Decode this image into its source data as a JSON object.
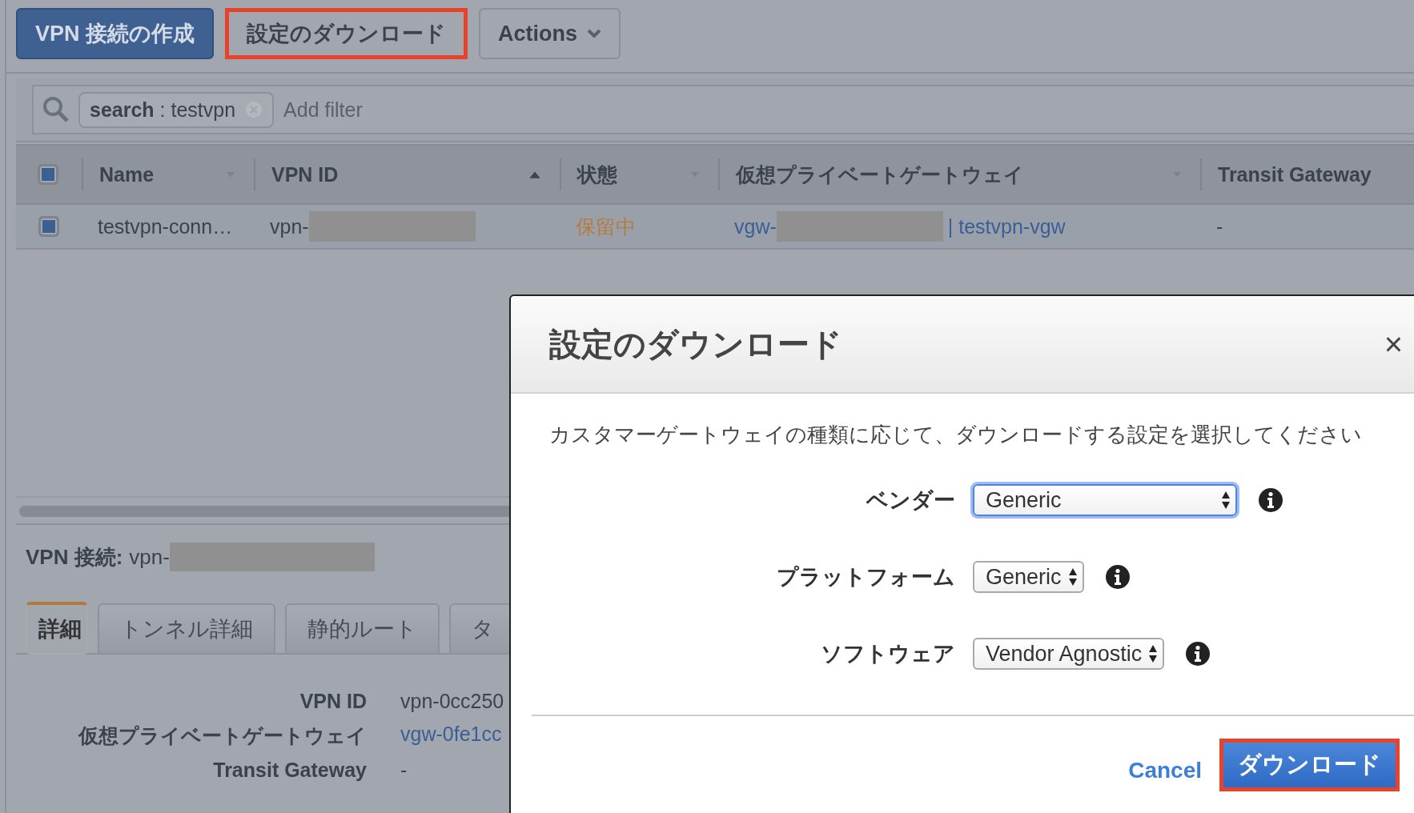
{
  "toolbar": {
    "buttons": [
      {
        "label": "VPN 接続の作成",
        "kind": "primary",
        "highlighted": false
      },
      {
        "label": "設定のダウンロード",
        "kind": "default",
        "highlighted": true
      },
      {
        "label": "Actions",
        "kind": "menu",
        "highlighted": false
      }
    ]
  },
  "filter": {
    "chip": "**search** : testvpn",
    "placeholder": "Add filter"
  },
  "table": {
    "all_checked": true,
    "columns": [
      {
        "label": "Name",
        "sorted": false
      },
      {
        "label": "VPN ID",
        "sorted": true
      },
      {
        "label": "状態",
        "sorted": false
      },
      {
        "label": "仮想プライベートゲートウェイ",
        "sorted": false
      },
      {
        "label": "Transit Gateway"
      }
    ],
    "rows": [
      {
        "checked": true,
        "name": "testvpn-conn…",
        "vpn_id": "vpn-",
        "state": "保留中",
        "vgw_prefix": "vgw-",
        "vgw_suffix": "| testvpn-vgw",
        "transit": "-"
      }
    ]
  },
  "detail": {
    "title": "VPN 接続:",
    "id_prefix": "vpn-",
    "tabs": [
      {
        "label": "詳細",
        "selected": true
      },
      {
        "label": "トンネル詳細",
        "selected": false
      },
      {
        "label": "静的ルート",
        "selected": false
      },
      {
        "label": "タ",
        "selected": false
      }
    ],
    "rows": [
      {
        "label": "VPN ID",
        "value": "vpn-0cc250",
        "kind": "text"
      },
      {
        "label": "仮想プライベートゲートウェイ",
        "value": "vgw-0fe1cc",
        "kind": "link"
      },
      {
        "label": "Transit Gateway",
        "value": "-",
        "kind": "text"
      }
    ]
  },
  "modal": {
    "title": "設定のダウンロード",
    "close": "×",
    "description": "カスタマーゲートウェイの種類に応じて、ダウンロードする設定を選択してください",
    "fields": [
      {
        "label": "ベンダー",
        "value": "Generic",
        "focused": true
      },
      {
        "label": "プラットフォーム",
        "value": "Generic",
        "focused": false
      },
      {
        "label": "ソフトウェア",
        "value": "Vendor Agnostic",
        "focused": false
      }
    ],
    "cancel": "Cancel",
    "confirm": {
      "label": "ダウンロード",
      "highlighted": true
    }
  }
}
